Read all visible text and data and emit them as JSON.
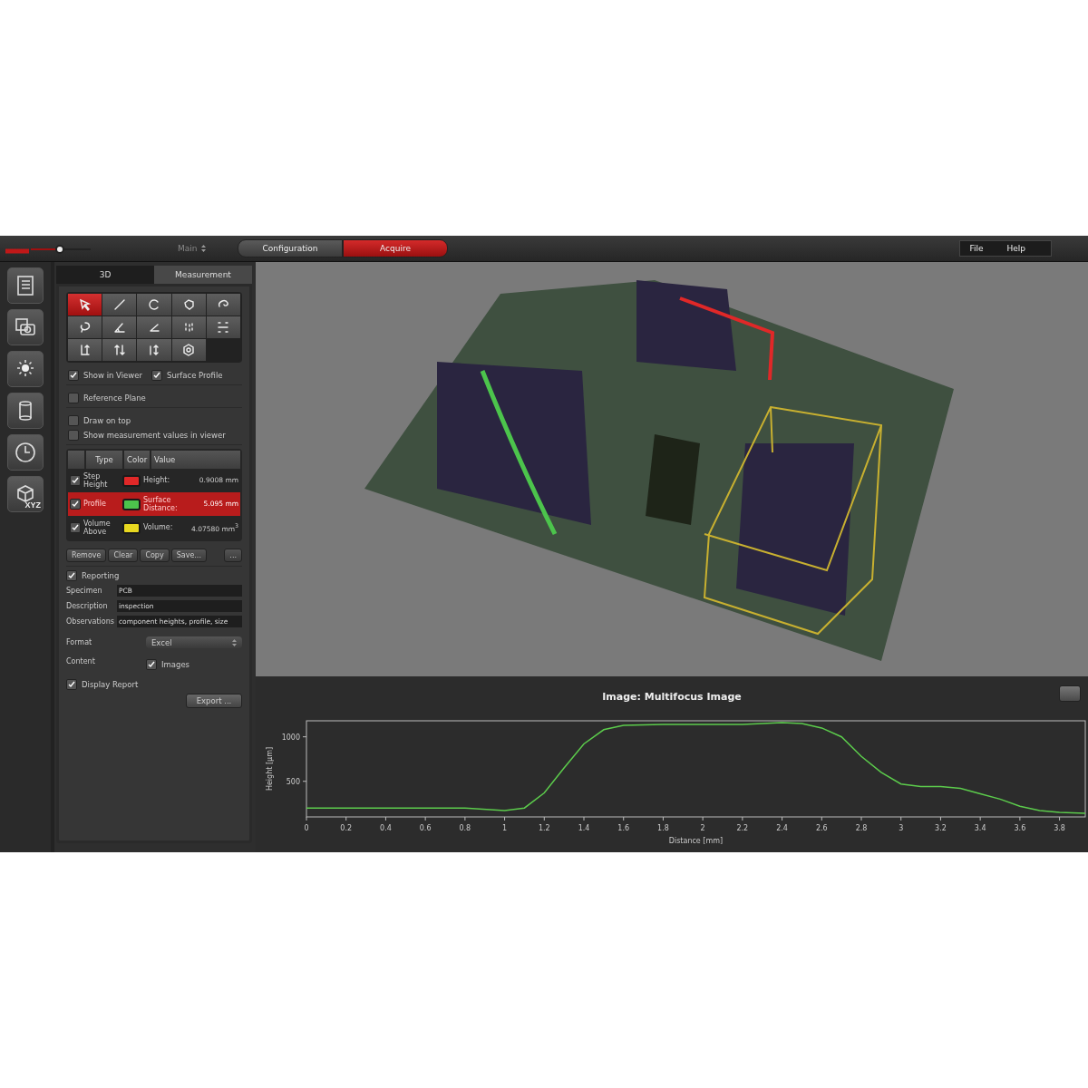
{
  "header": {
    "mode_select": "Main",
    "workflow": [
      {
        "label": "Configuration",
        "selected": false
      },
      {
        "label": "Acquire",
        "selected": true
      }
    ],
    "menu": [
      "File",
      "Help"
    ]
  },
  "side_toolbar": [
    {
      "kind": "list"
    },
    {
      "kind": "camera"
    },
    {
      "kind": "light"
    },
    {
      "kind": "cylinder"
    },
    {
      "kind": "clock"
    },
    {
      "kind": "cube",
      "label": "XYZ"
    }
  ],
  "panel_tabs": [
    {
      "label": "3D",
      "selected": false
    },
    {
      "label": "Measurement",
      "selected": true
    }
  ],
  "tools": [
    {
      "kind": "pointer",
      "selected": true
    },
    {
      "kind": "line",
      "selected": false
    },
    {
      "kind": "arc",
      "selected": false
    },
    {
      "kind": "polygon",
      "selected": false
    },
    {
      "kind": "freehand",
      "selected": false
    },
    {
      "kind": "lasso",
      "selected": false
    },
    {
      "kind": "angle",
      "selected": false
    },
    {
      "kind": "angle2",
      "selected": false
    },
    {
      "kind": "points",
      "selected": false
    },
    {
      "kind": "distance",
      "selected": false
    },
    {
      "kind": "height",
      "selected": false
    },
    {
      "kind": "height2",
      "selected": false
    },
    {
      "kind": "height3",
      "selected": false
    },
    {
      "kind": "volume",
      "selected": false
    }
  ],
  "option_groups": [
    [
      {
        "label": "Show in Viewer",
        "checked": true
      },
      {
        "label": "Surface Profile",
        "checked": true
      }
    ],
    [
      {
        "label": "Reference Plane",
        "checked": false
      }
    ],
    [
      {
        "label": "Draw on top",
        "checked": false
      },
      {
        "label": "Show measurement values in viewer",
        "checked": false
      }
    ]
  ],
  "measurements": {
    "columns": [
      "Type",
      "Color",
      "Value"
    ],
    "rows": [
      {
        "checked": true,
        "type": "Step Height",
        "color": "#e02828",
        "value_label": "Height:",
        "value": "0.9008 mm",
        "selected": false
      },
      {
        "checked": true,
        "type": "Profile",
        "color": "#4cc44c",
        "value_label": "Surface Distance:",
        "value": "5.095 mm",
        "selected": true
      },
      {
        "checked": true,
        "type": "Volume Above",
        "color": "#e8d820",
        "value_label": "Volume:",
        "value": "4.07580 mm$^{3}$",
        "selected": false
      }
    ]
  },
  "measurement_buttons": [
    "Remove",
    "Clear",
    "Copy",
    "Save...",
    "..."
  ],
  "reporting": {
    "label": "Reporting",
    "checked": true,
    "fields": [
      {
        "label": "Specimen",
        "value": "PCB"
      },
      {
        "label": "Description",
        "value": "inspection"
      },
      {
        "label": "Observations",
        "value": "component heights, profile, size"
      }
    ],
    "format": {
      "label": "Format",
      "value": "Excel"
    },
    "content": {
      "label": "Content",
      "option": "Images",
      "checked": true
    },
    "display_report": {
      "label": "Display Report",
      "checked": true
    },
    "export": "Export ..."
  },
  "chart": {
    "title": "Image: Multifocus Image",
    "chart_data": {
      "type": "line",
      "xlabel": "Distance [mm]",
      "ylabel": "Height [µm]",
      "xlim": [
        0,
        3.93
      ],
      "ylim": [
        100,
        1180
      ],
      "xticks": [
        0,
        0.2,
        0.4,
        0.6,
        0.8,
        1,
        1.2,
        1.4,
        1.6,
        1.8,
        2,
        2.2,
        2.4,
        2.6,
        2.8,
        3,
        3.2,
        3.4,
        3.6,
        3.8
      ],
      "yticks": [
        500,
        1000
      ],
      "x": [
        0,
        0.2,
        0.4,
        0.6,
        0.8,
        1.0,
        1.1,
        1.2,
        1.3,
        1.4,
        1.5,
        1.6,
        1.8,
        2.0,
        2.2,
        2.4,
        2.5,
        2.6,
        2.7,
        2.8,
        2.9,
        3.0,
        3.1,
        3.2,
        3.3,
        3.4,
        3.5,
        3.6,
        3.7,
        3.8,
        3.93
      ],
      "series": [
        {
          "color": "#5ccc4c",
          "values": [
            200,
            200,
            200,
            200,
            200,
            170,
            200,
            370,
            650,
            920,
            1080,
            1130,
            1140,
            1140,
            1140,
            1160,
            1150,
            1100,
            1000,
            780,
            600,
            470,
            440,
            440,
            420,
            360,
            300,
            220,
            170,
            150,
            140
          ]
        }
      ]
    }
  }
}
